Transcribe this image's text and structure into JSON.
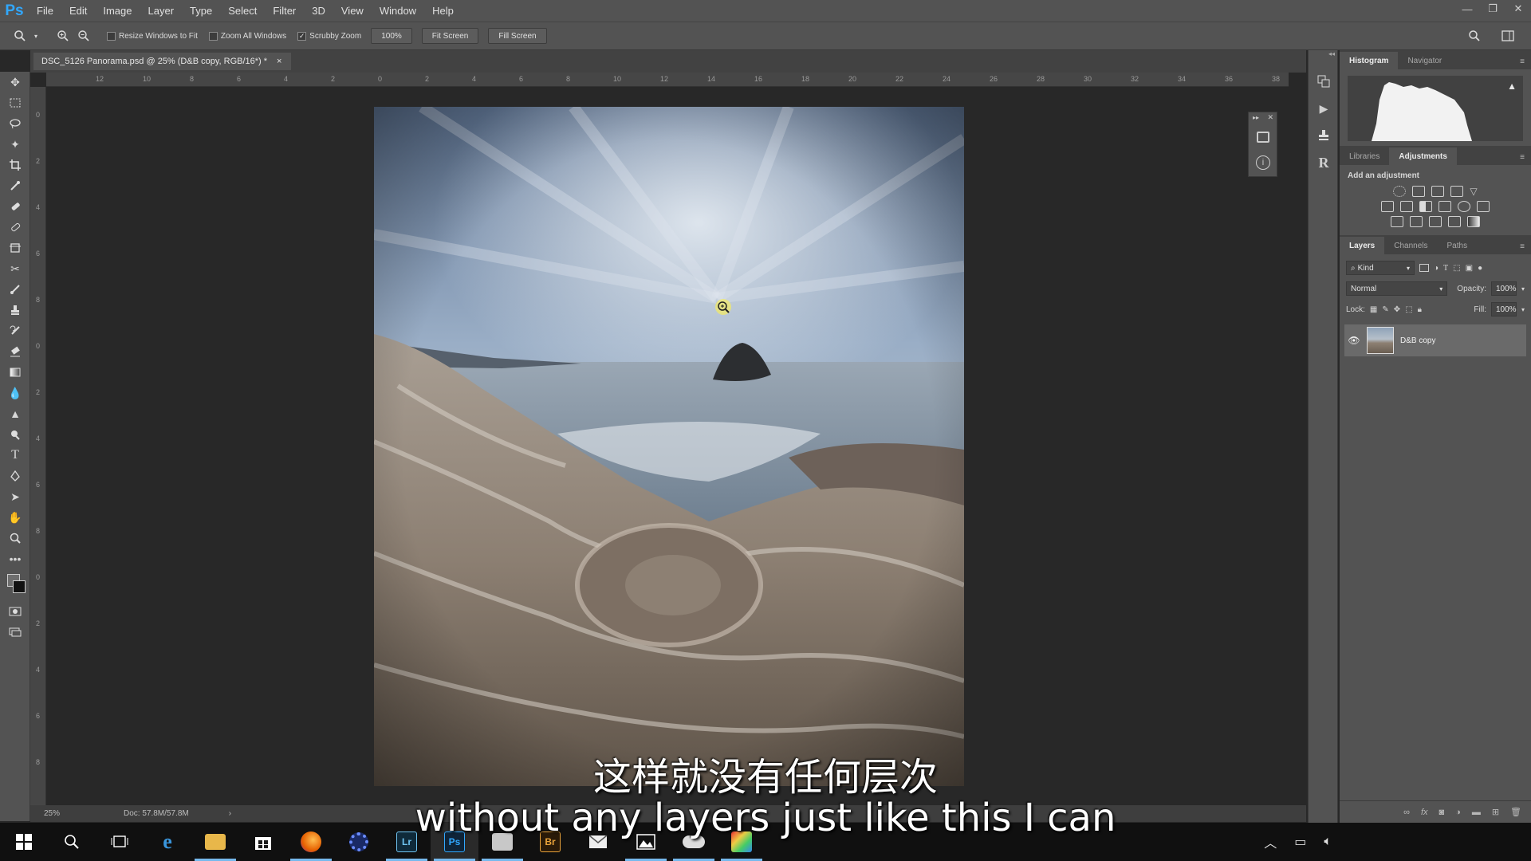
{
  "app": {
    "logo": "Ps"
  },
  "menu": [
    "File",
    "Edit",
    "Image",
    "Layer",
    "Type",
    "Select",
    "Filter",
    "3D",
    "View",
    "Window",
    "Help"
  ],
  "options": {
    "resize_windows": "Resize Windows to Fit",
    "zoom_all": "Zoom All Windows",
    "scrubby": "Scrubby Zoom",
    "zoom_value": "100%",
    "fit_screen": "Fit Screen",
    "fill_screen": "Fill Screen"
  },
  "document": {
    "tab_title": "DSC_5126 Panorama.psd @ 25% (D&B copy, RGB/16*) *",
    "close": "×"
  },
  "ruler_top": [
    "12",
    "10",
    "8",
    "6",
    "4",
    "2",
    "0",
    "2",
    "4",
    "6",
    "8",
    "10",
    "12",
    "14",
    "16",
    "18",
    "20",
    "22",
    "24",
    "26",
    "28",
    "30",
    "32",
    "34",
    "36",
    "38"
  ],
  "ruler_left": [
    "0",
    "2",
    "4",
    "6",
    "8",
    "0",
    "2",
    "4",
    "6",
    "8",
    "0",
    "2",
    "4",
    "6",
    "8"
  ],
  "status": {
    "zoom": "25%",
    "doc": "Doc: 57.8M/57.8M"
  },
  "panels": {
    "histogram_tabs": [
      "Histogram",
      "Navigator"
    ],
    "adjust_tabs": [
      "Libraries",
      "Adjustments"
    ],
    "add_adjustment": "Add an adjustment",
    "layer_tabs": [
      "Layers",
      "Channels",
      "Paths"
    ],
    "kind": "Kind",
    "blend_mode": "Normal",
    "opacity_label": "Opacity:",
    "opacity_value": "100%",
    "lock_label": "Lock:",
    "fill_label": "Fill:",
    "fill_value": "100%",
    "layer_name": "D&B copy"
  },
  "subtitles": {
    "cn": "这样就没有任何层次",
    "en": "without any layers just like this I can"
  },
  "colors": {
    "ps_blue": "#31a8ff",
    "panel_bg": "#535353",
    "canvas_bg": "#282828"
  }
}
